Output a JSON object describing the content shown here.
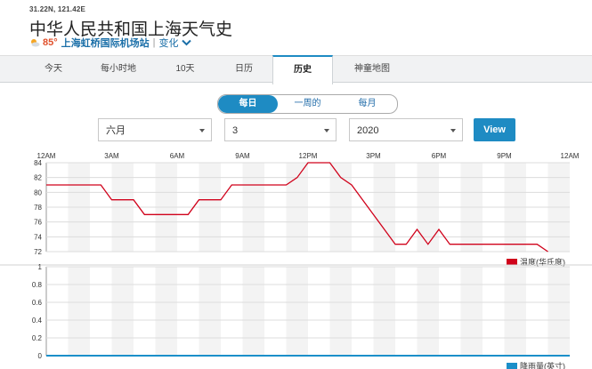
{
  "header": {
    "coords": "31.22N, 121.42E",
    "title": "中华人民共和国上海天气史",
    "current_temp": "85°",
    "station": "上海虹桥国际机场站",
    "change_label": "变化"
  },
  "tabs": [
    "今天",
    "每小时地",
    "10天",
    "日历",
    "历史",
    "神童地图"
  ],
  "active_tab": "历史",
  "period_options": [
    "每日",
    "一周的",
    "每月"
  ],
  "active_period": "每日",
  "filters": {
    "month": "六月",
    "day": "3",
    "year": "2020",
    "view_label": "View"
  },
  "colors": {
    "accent": "#1e8bc3",
    "temperature": "#d0021b",
    "precip": "#1b8fc9"
  },
  "chart_data": [
    {
      "type": "line",
      "x_ticks": [
        "12AM",
        "3AM",
        "6AM",
        "9AM",
        "12PM",
        "3PM",
        "6PM",
        "9PM",
        "12AM"
      ],
      "x_range_hours": [
        0,
        24
      ],
      "ylim": [
        72,
        84
      ],
      "y_ticks": [
        "84",
        "82",
        "80",
        "78",
        "76",
        "74",
        "72"
      ],
      "grid": true,
      "legend_position": "bottom-right",
      "series": [
        {
          "name": "温度(华氏度)",
          "x_hours": [
            0,
            2.5,
            3,
            4,
            4.5,
            6.5,
            7,
            8,
            8.5,
            11,
            11.5,
            12,
            13,
            13.5,
            14,
            14.5,
            16,
            16.5,
            17,
            17.5,
            18,
            18.5,
            22.5,
            23
          ],
          "values": [
            81,
            81,
            79,
            79,
            77,
            77,
            79,
            79,
            81,
            81,
            82,
            84,
            84,
            82,
            81,
            79,
            73,
            73,
            75,
            73,
            75,
            73,
            73,
            72
          ]
        }
      ]
    },
    {
      "type": "area",
      "x_range_hours": [
        0,
        24
      ],
      "ylim": [
        0,
        1
      ],
      "y_ticks": [
        "1",
        "0.8",
        "0.6",
        "0.4",
        "0.2",
        "0"
      ],
      "grid": true,
      "legend_position": "bottom-right",
      "series": [
        {
          "name": "降雨量(英寸)",
          "x_hours": [
            0,
            24
          ],
          "values": [
            0,
            0
          ]
        }
      ]
    }
  ]
}
